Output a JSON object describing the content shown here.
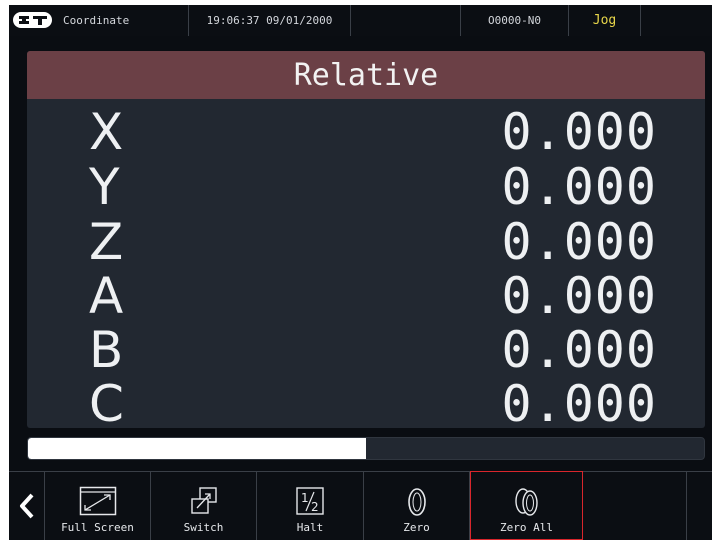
{
  "header": {
    "title": "Coordinate",
    "datetime": "19:06:37 09/01/2000",
    "program": "O0000-N0",
    "mode": "Jog"
  },
  "panel": {
    "title": "Relative",
    "axes": [
      {
        "label": "X",
        "value": "0.000"
      },
      {
        "label": "Y",
        "value": "0.000"
      },
      {
        "label": "Z",
        "value": "0.000"
      },
      {
        "label": "A",
        "value": "0.000"
      },
      {
        "label": "B",
        "value": "0.000"
      },
      {
        "label": "C",
        "value": "0.000"
      }
    ]
  },
  "progress": {
    "fraction": 0.5
  },
  "toolbar": {
    "buttons": [
      {
        "label": "Full Screen",
        "icon": "full-screen-icon"
      },
      {
        "label": "Switch",
        "icon": "switch-icon"
      },
      {
        "label": "Halt",
        "icon": "half-icon"
      },
      {
        "label": "Zero",
        "icon": "zero-icon"
      },
      {
        "label": "Zero All",
        "icon": "zero-all-icon",
        "selected": true
      }
    ]
  },
  "colors": {
    "title_bar": "#6b4046",
    "panel_bg": "#222831",
    "mode_text": "#e8d64a",
    "selection_border": "#d9262c"
  }
}
